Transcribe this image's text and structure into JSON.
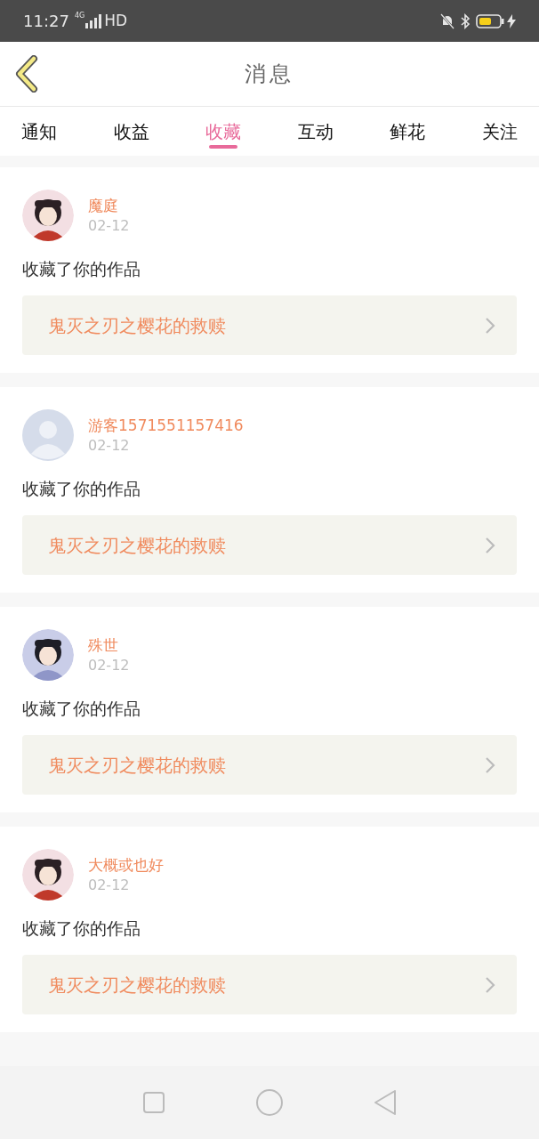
{
  "status_bar": {
    "time": "11:27",
    "network": "4G",
    "hd": "HD"
  },
  "header": {
    "title": "消息"
  },
  "tabs": [
    {
      "label": "通知",
      "selected": false
    },
    {
      "label": "收益",
      "selected": false
    },
    {
      "label": "收藏",
      "selected": true
    },
    {
      "label": "互动",
      "selected": false
    },
    {
      "label": "鲜花",
      "selected": false
    },
    {
      "label": "关注",
      "selected": false
    }
  ],
  "messages": [
    {
      "user": "魔庭",
      "kind": "picture",
      "date": "02-12",
      "action": "收藏了你的作品",
      "work": "鬼灭之刃之樱花的救赎"
    },
    {
      "user": "游客1571551157416",
      "kind": "default",
      "date": "02-12",
      "action": "收藏了你的作品",
      "work": "鬼灭之刃之樱花的救赎"
    },
    {
      "user": "殊世",
      "kind": "picture",
      "date": "02-12",
      "action": "收藏了你的作品",
      "work": "鬼灭之刃之樱花的救赎"
    },
    {
      "user": "大概或也好",
      "kind": "picture",
      "date": "02-12",
      "action": "收藏了你的作品",
      "work": "鬼灭之刃之樱花的救赎"
    }
  ]
}
